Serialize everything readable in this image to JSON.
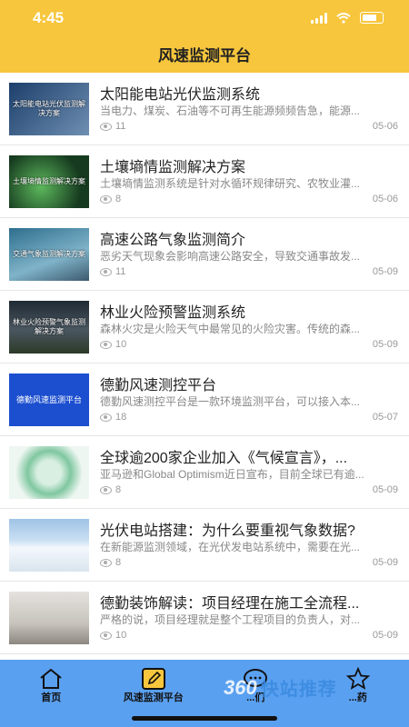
{
  "status": {
    "time": "4:45"
  },
  "header": {
    "title": "风速监测平台"
  },
  "articles": [
    {
      "title": "太阳能电站光伏监测系统",
      "summary": "当电力、煤炭、石油等不可再生能源频频告急，能源...",
      "views": "11",
      "date": "05-06",
      "thumb_text": "太阳能电站光伏监测解决方案"
    },
    {
      "title": "土壤墒情监测解决方案",
      "summary": "土壤墒情监测系统是针对水循环规律研究、农牧业灌...",
      "views": "8",
      "date": "05-06",
      "thumb_text": "土壤墒情监测解决方案"
    },
    {
      "title": "高速公路气象监测简介",
      "summary": "恶劣天气现象会影响高速公路安全，导致交通事故发...",
      "views": "11",
      "date": "05-09",
      "thumb_text": "交通气象监测解决方案"
    },
    {
      "title": "林业火险预警监测系统",
      "summary": "森林火灾是火险天气中最常见的火险灾害。传统的森...",
      "views": "10",
      "date": "05-09",
      "thumb_text": "林业火险预警气象监测解决方案"
    },
    {
      "title": "德勤风速测控平台",
      "summary": "德勤风速测控平台是一款环境监测平台，可以接入本...",
      "views": "18",
      "date": "05-07",
      "thumb_text": "德勤风速监测平台"
    },
    {
      "title": "全球逾200家企业加入《气候宣言》，...",
      "summary": "亚马逊和Global Optimism近日宣布，目前全球已有逾...",
      "views": "8",
      "date": "05-09",
      "thumb_text": ""
    },
    {
      "title": "光伏电站搭建：为什么要重视气象数据?",
      "summary": "在新能源监测领域，在光伏发电站系统中，需要在光...",
      "views": "8",
      "date": "05-09",
      "thumb_text": ""
    },
    {
      "title": "德勤装饰解读：项目经理在施工全流程...",
      "summary": "严格的说，项目经理就是整个工程项目的负责人，对...",
      "views": "10",
      "date": "05-09",
      "thumb_text": ""
    }
  ],
  "tabs": [
    {
      "label": "首页",
      "icon": "home-icon"
    },
    {
      "label": "风速监测平台",
      "icon": "edit-icon"
    },
    {
      "label": "...们",
      "icon": "chat-icon"
    },
    {
      "label": "...药",
      "icon": "star-icon"
    }
  ],
  "watermark": {
    "logo": "360",
    "text": "快站推荐"
  }
}
